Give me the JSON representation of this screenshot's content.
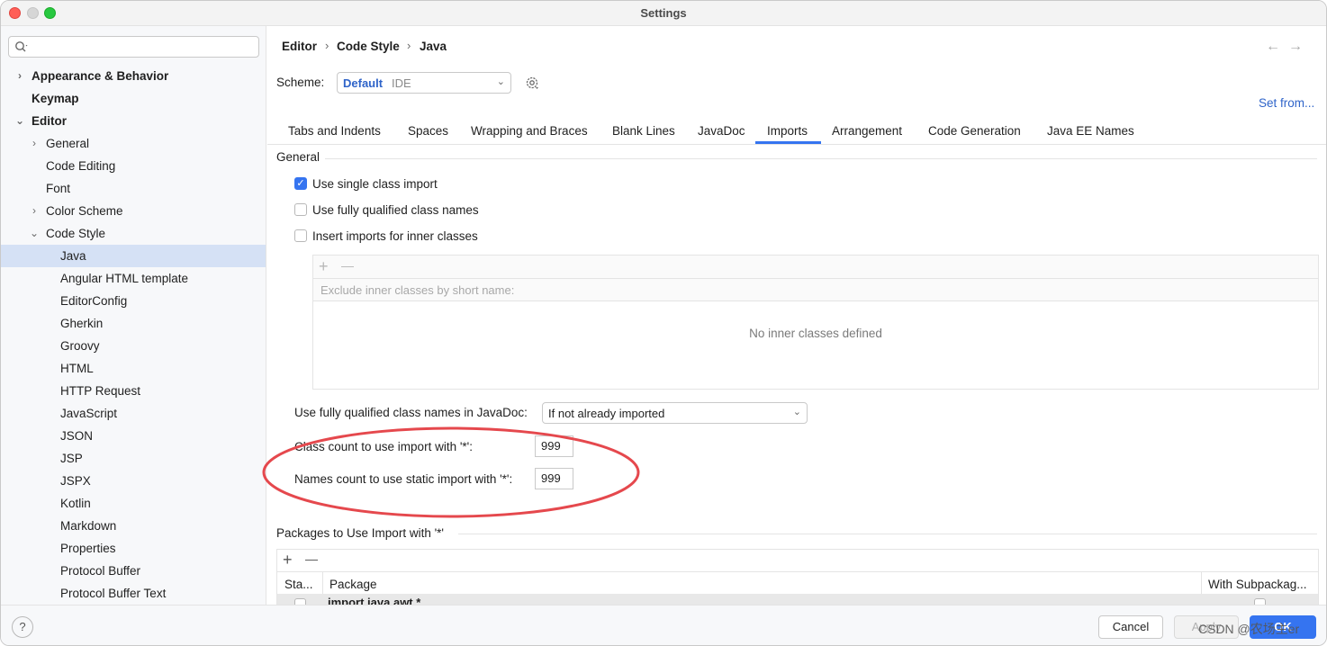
{
  "window": {
    "title": "Settings"
  },
  "search": {
    "value": "",
    "placeholder": ""
  },
  "sidebar": {
    "items": [
      {
        "label": "Appearance & Behavior",
        "chevron": "›"
      },
      {
        "label": "Keymap"
      },
      {
        "label": "Editor",
        "chevron": "⌄"
      },
      {
        "label": "General",
        "chevron": "›"
      },
      {
        "label": "Code Editing"
      },
      {
        "label": "Font"
      },
      {
        "label": "Color Scheme",
        "chevron": "›"
      },
      {
        "label": "Code Style",
        "chevron": "⌄"
      },
      {
        "label": "Java",
        "selected": true
      },
      {
        "label": "Angular HTML template"
      },
      {
        "label": "EditorConfig"
      },
      {
        "label": "Gherkin"
      },
      {
        "label": "Groovy"
      },
      {
        "label": "HTML"
      },
      {
        "label": "HTTP Request"
      },
      {
        "label": "JavaScript"
      },
      {
        "label": "JSON"
      },
      {
        "label": "JSP"
      },
      {
        "label": "JSPX"
      },
      {
        "label": "Kotlin"
      },
      {
        "label": "Markdown"
      },
      {
        "label": "Properties"
      },
      {
        "label": "Protocol Buffer"
      },
      {
        "label": "Protocol Buffer Text"
      }
    ]
  },
  "breadcrumb": {
    "items": [
      "Editor",
      "Code Style",
      "Java"
    ],
    "separator": "›"
  },
  "nav": {
    "back": "←",
    "forward": "→"
  },
  "scheme": {
    "label": "Scheme:",
    "value": "Default",
    "type": "IDE"
  },
  "set_from": "Set from...",
  "tabs": [
    {
      "label": "Tabs and Indents"
    },
    {
      "label": "Spaces"
    },
    {
      "label": "Wrapping and Braces"
    },
    {
      "label": "Blank Lines"
    },
    {
      "label": "JavaDoc"
    },
    {
      "label": "Imports",
      "active": true
    },
    {
      "label": "Arrangement"
    },
    {
      "label": "Code Generation"
    },
    {
      "label": "Java EE Names"
    }
  ],
  "general": {
    "title": "General",
    "use_single_class_import": {
      "label": "Use single class import",
      "checked": true
    },
    "use_fully_qualified": {
      "label": "Use fully qualified class names",
      "checked": false
    },
    "insert_inner": {
      "label": "Insert imports for inner classes",
      "checked": false
    },
    "add": "+",
    "remove": "—",
    "exclude_header": "Exclude inner classes by short name:",
    "empty_text": "No inner classes defined",
    "javadoc_label": "Use fully qualified class names in JavaDoc:",
    "javadoc_value": "If not already imported",
    "class_count_label": "Class count to use import with '*':",
    "class_count_value": "999",
    "names_count_label": "Names count to use static import with '*':",
    "names_count_value": "999"
  },
  "packages": {
    "title": "Packages to Use Import with '*'",
    "add": "+",
    "remove": "—",
    "columns": [
      "Sta...",
      "Package",
      "With Subpackag..."
    ],
    "rows": [
      {
        "package": "import java.awt.*"
      }
    ]
  },
  "footer": {
    "help": "?",
    "cancel": "Cancel",
    "apply": "Apply",
    "ok": "OK"
  },
  "watermark": "CSDN @农场主er",
  "colors": {
    "accent": "#3574f0",
    "highlight_ellipse": "#e5484d"
  }
}
